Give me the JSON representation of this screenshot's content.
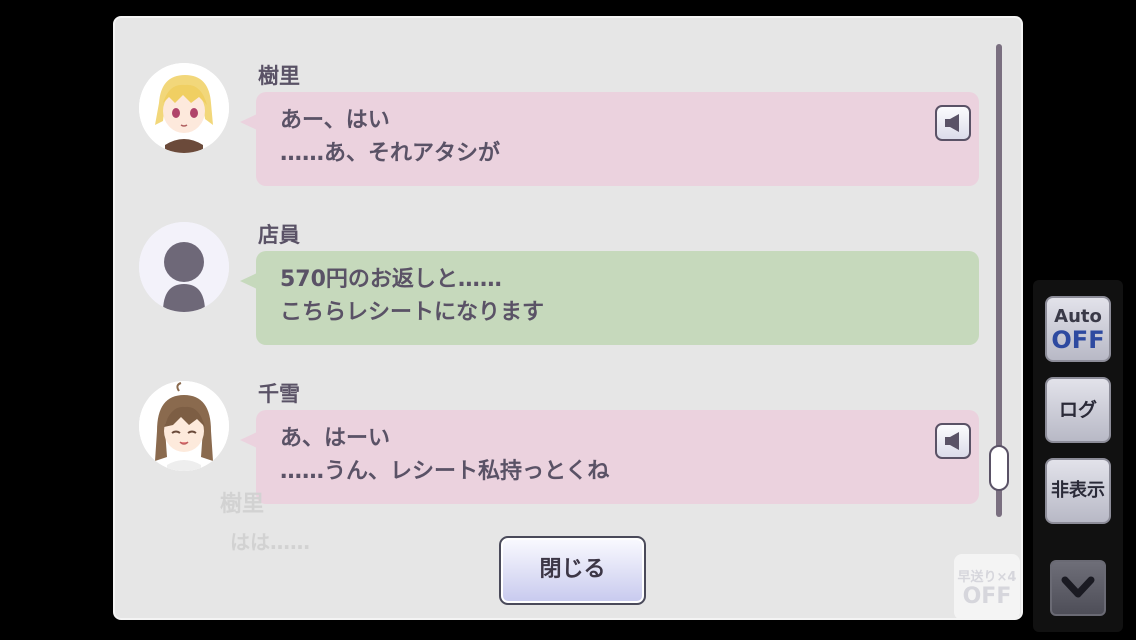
{
  "log": {
    "entries": [
      {
        "speaker": "樹里",
        "lines": [
          "あー、はい",
          "……あ、それアタシが"
        ],
        "has_voice": true,
        "color": "#ebd2de"
      },
      {
        "speaker": "店員",
        "lines": [
          "570円のお返しと……",
          "こちらレシートになります"
        ],
        "has_voice": false,
        "color": "#c6d9bc"
      },
      {
        "speaker": "千雪",
        "lines": [
          "あ、はーい",
          "……うん、レシート私持っとくね"
        ],
        "has_voice": true,
        "color": "#ebd2de"
      }
    ],
    "close_label": "閉じる"
  },
  "background": {
    "speaker": "樹里",
    "text": "はは……"
  },
  "side": {
    "auto_label": "Auto",
    "auto_state": "OFF",
    "log_label": "ログ",
    "hide_label": "非表示",
    "speed_label": "早送り×4",
    "speed_state": "OFF"
  }
}
